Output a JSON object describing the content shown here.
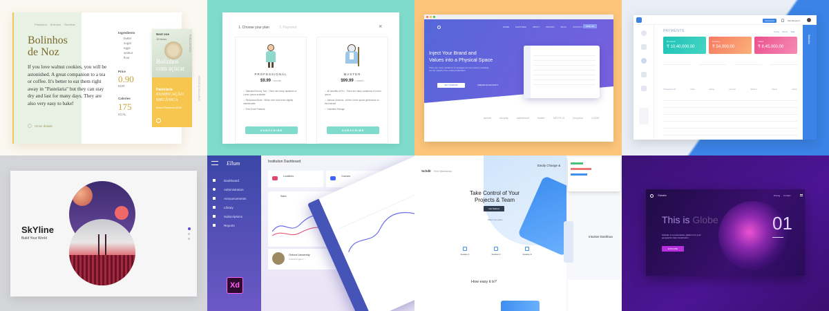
{
  "tile1": {
    "breadcrumb": [
      "Pastelaria",
      "Bolinhos",
      "Receitas"
    ],
    "title_line1": "Bolinhos",
    "title_line2": "de Noz",
    "description": "If you love walnut cookies, you will be astonished. A great companion to a tea or coffee. It's better to eat them right away in \"Pastelaria\" but they can stay dry and last for many days. They are also very easy to bake!",
    "ingredients_label": "Ingredients",
    "ingredients": [
      "butter",
      "sugar",
      "eggs",
      "walnut",
      "flour"
    ],
    "price_label": "Price",
    "price_value": "0.90",
    "price_unit": "EUR",
    "calories_label": "Calories",
    "calories_value": "175",
    "calories_unit": "KCAL",
    "next_label": "Next one",
    "next_sub": "15 items",
    "next_title_line1": "Bolinhos",
    "next_title_line2": "com açúcar",
    "category_label": "Pastelaria",
    "category_title_line1": "PANIFICAÇÃO",
    "category_title_line2": "MECÂNICA",
    "category_sub": "Barra Rossana 2016",
    "close_link": "Close details",
    "side_text_1": "PUBLICATIONS",
    "side_text_2": "RECEITAS BOLINHOS"
  },
  "tile2": {
    "step1": "1. Choose your plan",
    "step2": "2. Payment",
    "plans": [
      {
        "name": "PROFESSIONAL",
        "price": "$9.99",
        "period": "/ month",
        "features": [
          "Standard Survey Tool - There are many variations of Lorem Ipsum available",
          "Reciprocal Mode - Which don't look even slightly unbelievable",
          "Free Excel Praisers"
        ],
        "button": "SUBSCRIBE"
      },
      {
        "name": "MASTER",
        "price": "$99.99",
        "period": "/ month",
        "features": [
          "All benefits of Pro - There are many variations of Lorem Ipsum",
          "Various Versions - All the Lorem Ipsum generators on the Internet",
          "Unlimited Storage"
        ],
        "button": "SUBSCRIBE"
      }
    ]
  },
  "tile3": {
    "nav": [
      "HOME",
      "FEATURES",
      "ABOUT",
      "PRICING",
      "BLOG",
      "CONTACT",
      "LOGIN"
    ],
    "nav_cta": "SIGN UP",
    "headline_line1": "Inject Your Brand and",
    "headline_line2": "Values into a Physical Space",
    "sub": "There are many variations of passages of Lorem Ipsum available, but the majority have suffered alteration",
    "cta_primary": "GET STARTED",
    "cta_secondary": "CREATE AN ACCOUNT",
    "logos": [
      "airbnb",
      "shopify",
      "salesforce",
      "twitter",
      "NETFLIX",
      "Dropbox",
      "CODE"
    ]
  },
  "tile4": {
    "top_button": "Download",
    "user_name": "Mat Benjamin",
    "page_title": "PAYMENTS",
    "filter_tabs": [
      "Today",
      "Month",
      "Year"
    ],
    "cards": [
      {
        "value": "₹ 10,40,000.00",
        "label": "Received",
        "color": "#20c6b6"
      },
      {
        "value": "₹ 54,000.00",
        "label": "Pending",
        "color": "#f8906a"
      },
      {
        "value": "₹ 8,45,000.00",
        "label": "Failed",
        "color": "#ef5f9a"
      }
    ],
    "table_headers": [
      "Transaction ID",
      "Date",
      "Name",
      "Amount",
      "Method",
      "Status",
      "Action"
    ],
    "table_rows": 6,
    "side_label": "Statistics"
  },
  "tile5": {
    "title": "SkYline",
    "subtitle": "Build Your World"
  },
  "tile6": {
    "brand": "Ellum",
    "page_title": "Institution Dashboard",
    "menu": [
      "Dashboard",
      "Administration",
      "Announcements",
      "Library",
      "Subscriptions",
      "Reports"
    ],
    "stat1_label": "Locations",
    "stat2_label": "Courses",
    "chart_title": "Sales",
    "university": "Oxford University",
    "university_sub": "United Kingdom",
    "badge": "Xd"
  },
  "tile7": {
    "brand": "Schdlr",
    "nav_link": "Free Wireframes",
    "headline_line1": "Take Control of Your",
    "headline_line2": "Projects & Team",
    "cta": "Get Started",
    "subtext": "Watch the video",
    "feature_labels": [
      "Feature 1",
      "Feature 2",
      "Feature 3"
    ],
    "how_title": "How easy it is?",
    "corner_text_line1": "Easily Change &",
    "right_heading": "Intuitive Dashboa"
  },
  "tile8": {
    "brand": "Globalio",
    "nav_items": [
      "Pricing",
      "Contact"
    ],
    "headline_prefix": "This is",
    "headline_word": "Globe",
    "counter": "01",
    "sub": "Globalio is a presentation platform for your geographic data visualization.",
    "cta": "EXPLORE"
  }
}
